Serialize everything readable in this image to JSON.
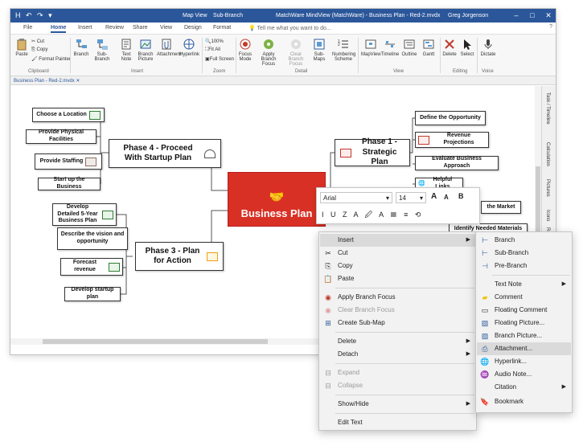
{
  "titlebar": {
    "quick_access": "H ↶ ↷ ▾",
    "context_tab_1": "Map View",
    "context_tab_2": "Sub-Branch",
    "title": "MatchWare MindView (MatchWare) - Business Plan - Red-2.mvdx",
    "user": "Greg Jorgenson",
    "minimize": "–",
    "restore": "□",
    "close": "✕",
    "help": "?"
  },
  "tabs": [
    "File",
    "Home",
    "Insert",
    "Review",
    "Share",
    "View",
    "Design",
    "Format"
  ],
  "tell_me": "Tell me what you want to do...",
  "ribbon": {
    "clipboard": {
      "paste": "Paste",
      "cut": "Cut",
      "copy": "Copy",
      "format_painter": "Format Painter",
      "group": "Clipboard"
    },
    "insert": {
      "branch": "Branch",
      "sub_branch": "Sub-Branch",
      "text_note": "Text Note",
      "branch_picture": "Branch Picture",
      "attachment": "Attachment",
      "hyperlink": "Hyperlink",
      "group": "Insert"
    },
    "zoom": {
      "pct": "100%",
      "fit_all": "Fit All",
      "full_screen": "Full Screen",
      "group": "Zoom"
    },
    "detail": {
      "focus_mode": "Focus Mode",
      "apply_branch_focus": "Apply Branch Focus",
      "clear_branch_focus": "Clear Branch Focus",
      "sub_maps": "Sub-Maps",
      "numbering_scheme": "Numbering Scheme",
      "group": "Detail"
    },
    "view": {
      "mapview": "MapView",
      "timeline": "Timeline",
      "outline": "Outline",
      "gantt": "Gantt",
      "group": "View"
    },
    "editing": {
      "delete": "Delete",
      "select": "Select",
      "group": "Editing"
    },
    "voice": {
      "dictate": "Dictate",
      "group": "Voice"
    }
  },
  "doc_tab": "Business Plan - Red-2.mvdx ✕",
  "side_panels": [
    "Task / Timeline",
    "Calculation",
    "Pictures",
    "Icons",
    "Rep"
  ],
  "map": {
    "central": "Business Plan",
    "phase1": "Phase 1 - Strategic Plan",
    "phase3": "Phase 3 - Plan for Action",
    "phase4": "Phase 4 - Proceed With Startup Plan",
    "p4_children": [
      "Choose a Location",
      "Provide Physical Facilities",
      "Provide Staffing",
      "Start up the Business"
    ],
    "p3_children": [
      "Develop Detailed 5-Year Business Plan",
      "Describe the vision and opportunity",
      "Forecast revenue",
      "Develop startup plan"
    ],
    "p1_children": [
      "Define the Opportunity",
      "Revenue Projections",
      "Evaluate Business Approach",
      "Helpful Links",
      "the Market",
      "Identify Needed Materials"
    ]
  },
  "format_bar": {
    "font": "Arial",
    "size": "14",
    "grow": "A",
    "shrink": "A",
    "bold": "B",
    "row2": "I U Z A 🖉 A ☰ ≡ ⟲"
  },
  "context_menu": {
    "insert": "Insert",
    "cut": "Cut",
    "copy": "Copy",
    "paste": "Paste",
    "apply_branch_focus": "Apply Branch Focus",
    "clear_branch_focus": "Clear Branch Focus",
    "create_sub_map": "Create Sub-Map",
    "delete": "Delete",
    "detach": "Detach",
    "expand": "Expand",
    "collapse": "Collapse",
    "show_hide": "Show/Hide",
    "edit_text": "Edit Text"
  },
  "submenu": {
    "branch": "Branch",
    "sub_branch": "Sub-Branch",
    "pre_branch": "Pre-Branch",
    "text_note": "Text Note",
    "comment": "Comment",
    "floating_comment": "Floating Comment",
    "floating_picture": "Floating Picture...",
    "branch_picture": "Branch Picture...",
    "attachment": "Attachment...",
    "hyperlink": "Hyperlink...",
    "audio_note": "Audio Note...",
    "citation": "Citation",
    "bookmark": "Bookmark"
  }
}
